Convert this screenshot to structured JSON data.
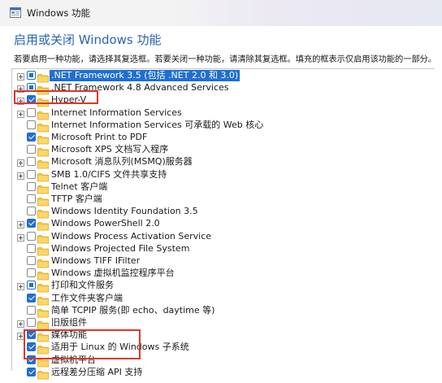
{
  "window": {
    "title": "Windows 功能",
    "heading": "启用或关闭 Windows 功能",
    "description": "若要启用一种功能，请选择其复选框。若要关闭一种功能，请清除其复选框。填充的框表示仅启用该功能的一部分。"
  },
  "colors": {
    "accent": "#1f6fd1",
    "heading": "#2b62b6",
    "highlight_box": "#e0352b",
    "folder": "#f5c542"
  },
  "features": [
    {
      "label": ".NET Framework 3.5 (包括 .NET 2.0 和 3.0)",
      "state": "partial",
      "expandable": true,
      "selected": true
    },
    {
      "label": ".NET Framework 4.8 Advanced Services",
      "state": "partial",
      "expandable": true
    },
    {
      "label": "Hyper-V",
      "state": "checked",
      "expandable": true
    },
    {
      "label": "Internet Information Services",
      "state": "unchecked",
      "expandable": true
    },
    {
      "label": "Internet Information Services 可承载的 Web 核心",
      "state": "unchecked",
      "expandable": false
    },
    {
      "label": "Microsoft Print to PDF",
      "state": "checked",
      "expandable": false
    },
    {
      "label": "Microsoft XPS 文档写入程序",
      "state": "unchecked",
      "expandable": false
    },
    {
      "label": "Microsoft 消息队列(MSMQ)服务器",
      "state": "unchecked",
      "expandable": true
    },
    {
      "label": "SMB 1.0/CIFS 文件共享支持",
      "state": "unchecked",
      "expandable": true
    },
    {
      "label": "Telnet 客户端",
      "state": "unchecked",
      "expandable": false
    },
    {
      "label": "TFTP 客户端",
      "state": "unchecked",
      "expandable": false
    },
    {
      "label": "Windows Identity Foundation 3.5",
      "state": "unchecked",
      "expandable": false
    },
    {
      "label": "Windows PowerShell 2.0",
      "state": "checked",
      "expandable": true
    },
    {
      "label": "Windows Process Activation Service",
      "state": "unchecked",
      "expandable": true
    },
    {
      "label": "Windows Projected File System",
      "state": "unchecked",
      "expandable": false
    },
    {
      "label": "Windows TIFF IFilter",
      "state": "unchecked",
      "expandable": false
    },
    {
      "label": "Windows 虚拟机监控程序平台",
      "state": "unchecked",
      "expandable": false
    },
    {
      "label": "打印和文件服务",
      "state": "partial",
      "expandable": true
    },
    {
      "label": "工作文件夹客户端",
      "state": "checked",
      "expandable": false
    },
    {
      "label": "简单 TCPIP 服务(即 echo、daytime 等)",
      "state": "unchecked",
      "expandable": false
    },
    {
      "label": "旧版组件",
      "state": "unchecked",
      "expandable": true
    },
    {
      "label": "媒体功能",
      "state": "checked",
      "expandable": true
    },
    {
      "label": "适用于 Linux 的 Windows 子系统",
      "state": "checked",
      "expandable": false
    },
    {
      "label": "虚拟机平台",
      "state": "checked",
      "expandable": false
    },
    {
      "label": "远程差分压缩 API 支持",
      "state": "checked",
      "expandable": false
    }
  ]
}
